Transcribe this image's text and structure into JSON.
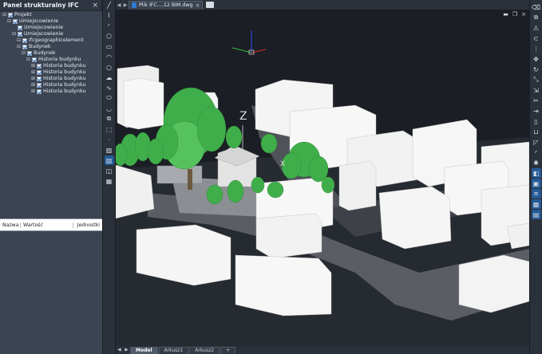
{
  "panel": {
    "title": "Panel strukturalny IFC",
    "close": "×",
    "tree": [
      {
        "indent": 0,
        "expander": "⊟",
        "label": "Projekt"
      },
      {
        "indent": 1,
        "expander": "⊟",
        "label": "Umiejscowienie"
      },
      {
        "indent": 2,
        "expander": "",
        "label": "Umiejscowienie"
      },
      {
        "indent": 2,
        "expander": "⊟",
        "label": "Umiejscowienie"
      },
      {
        "indent": 3,
        "expander": "⊟",
        "label": "ifcgeographicelement"
      },
      {
        "indent": 3,
        "expander": "⊟",
        "label": "Budynek"
      },
      {
        "indent": 4,
        "expander": "⊟",
        "label": "Budynek"
      },
      {
        "indent": 5,
        "expander": "⊟",
        "label": "Historia budynku"
      },
      {
        "indent": 6,
        "expander": "⊞",
        "label": "Historia budynku"
      },
      {
        "indent": 6,
        "expander": "⊞",
        "label": "Historia budynku"
      },
      {
        "indent": 6,
        "expander": "⊞",
        "label": "Historia budynku"
      },
      {
        "indent": 6,
        "expander": "⊞",
        "label": "Historia budynku"
      },
      {
        "indent": 6,
        "expander": "⊞",
        "label": "Historia budynku"
      }
    ]
  },
  "properties": {
    "col_name": "Nazwa",
    "col_value": "Wartość",
    "col_unit": "Jednostki"
  },
  "tabs": {
    "prev": "◀",
    "next": "▶",
    "document": "Plik IFC....12 BIM.dwg",
    "close": "×"
  },
  "window_controls": {
    "minimize": "▬",
    "restore": "❐",
    "close": "×"
  },
  "viewport": {
    "ucs_label": "Z",
    "x_label": "X",
    "background": "#1b1e24",
    "building_color": "#f2f2f2",
    "tree_color": "#3fae4a"
  },
  "layout_tabs": {
    "nav": [
      "◀",
      "▶"
    ],
    "tabs": [
      "Model",
      "Arkusz1",
      "Arkusz2"
    ],
    "active": "Model",
    "add": "+"
  },
  "icons": {
    "left": [
      "line-icon",
      "polyline-icon",
      "arc-icon",
      "pentagon-icon",
      "rectangle-icon",
      "arc2-icon",
      "circle-icon",
      "cloud-icon",
      "spline-icon",
      "ellipse-icon",
      "ellipse-arc-icon",
      "insert-block-icon",
      "make-block-icon",
      "point-icon",
      "hatch-icon",
      "gradient-icon",
      "region-icon",
      "table-icon"
    ],
    "right": [
      "eraser-icon",
      "copy-icon",
      "mirror-icon",
      "offset-icon",
      "array-icon",
      "move-icon",
      "rotate-icon",
      "scale-icon",
      "stretch-icon",
      "trim-icon",
      "extend-icon",
      "break-icon",
      "join-icon",
      "chamfer-icon",
      "fillet-icon",
      "explode-icon",
      "layer-icon",
      "properties-icon",
      "draworder-icon",
      "group-icon",
      "ungroup-icon"
    ]
  }
}
